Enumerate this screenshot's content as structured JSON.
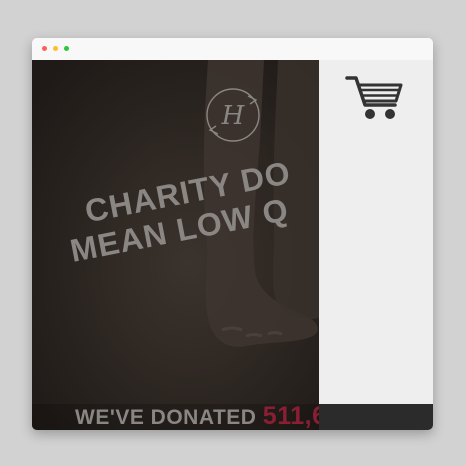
{
  "window": {
    "controls": [
      "close",
      "minimize",
      "maximize"
    ]
  },
  "hero": {
    "logo_letter": "H",
    "headline_line1": "CHARITY DO",
    "headline_line2": "MEAN LOW Q",
    "donated_label": "WE'VE  DONATED",
    "donated_value": "511,6",
    "colors": {
      "text": "#8a8683",
      "accent": "#8a1e34",
      "background": "#2a2420"
    }
  },
  "sidebar": {
    "cart_icon": "shopping-cart-icon",
    "background": "#eeeeee",
    "footer_color": "#2b2b2b"
  }
}
